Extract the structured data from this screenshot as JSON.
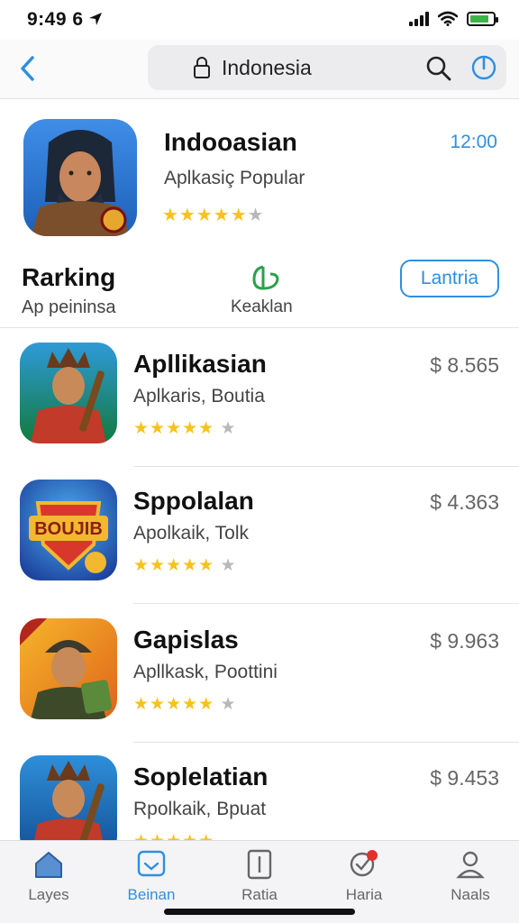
{
  "status": {
    "time": "9:49 6"
  },
  "search": {
    "query": "Indonesia"
  },
  "featured": {
    "title": "Indooasian",
    "subtitle": "Aplkasiç Popular",
    "time": "12:00",
    "rating": 4.5
  },
  "ranking": {
    "title": "Rarking",
    "subtitle": "Ap peininsa",
    "mid_label": "Keaklan",
    "button": "Lantria"
  },
  "apps": [
    {
      "name": "Apllikasian",
      "category": "Aplkaris, Boutia",
      "price": "$ 8.565",
      "rating": 5
    },
    {
      "name": "Sppolalan",
      "category": "Apolkaik, Tolk",
      "price": "$ 4.363",
      "rating": 5
    },
    {
      "name": "Gapislas",
      "category": "Apllkask, Poottini",
      "price": "$ 9.963",
      "rating": 5
    },
    {
      "name": "Soplelatian",
      "category": "Rpolkaik, Bpuat",
      "price": "$ 9.453",
      "rating": 5
    }
  ],
  "tabs": [
    {
      "label": "Layes",
      "icon": "home-icon"
    },
    {
      "label": "Beinan",
      "icon": "message-icon"
    },
    {
      "label": "Ratia",
      "icon": "document-icon"
    },
    {
      "label": "Haria",
      "icon": "badge-icon"
    },
    {
      "label": "Naals",
      "icon": "person-icon"
    }
  ],
  "colors": {
    "accent": "#2f8fe0",
    "star": "#f6c21c",
    "battery": "#3bb54a",
    "green": "#2aa14a"
  }
}
